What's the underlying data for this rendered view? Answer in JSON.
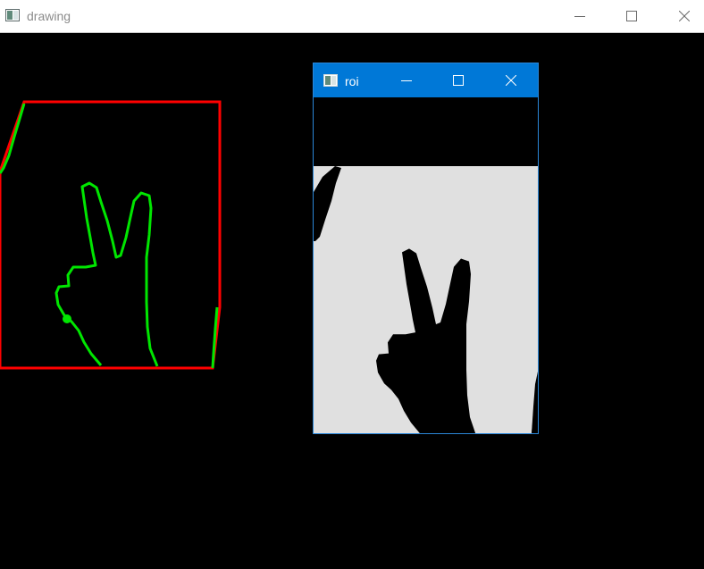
{
  "main_window": {
    "title": "drawing",
    "controls": [
      "minimize",
      "maximize",
      "close"
    ]
  },
  "roi_window": {
    "title": "roi",
    "controls": [
      "minimize",
      "maximize",
      "close"
    ]
  },
  "colors": {
    "background": "#000000",
    "bounding_box": "#ff0000",
    "hand_contour": "#00e600",
    "roi_foreground": "#e0e0e0",
    "roi_titlebar": "#0078d7"
  }
}
